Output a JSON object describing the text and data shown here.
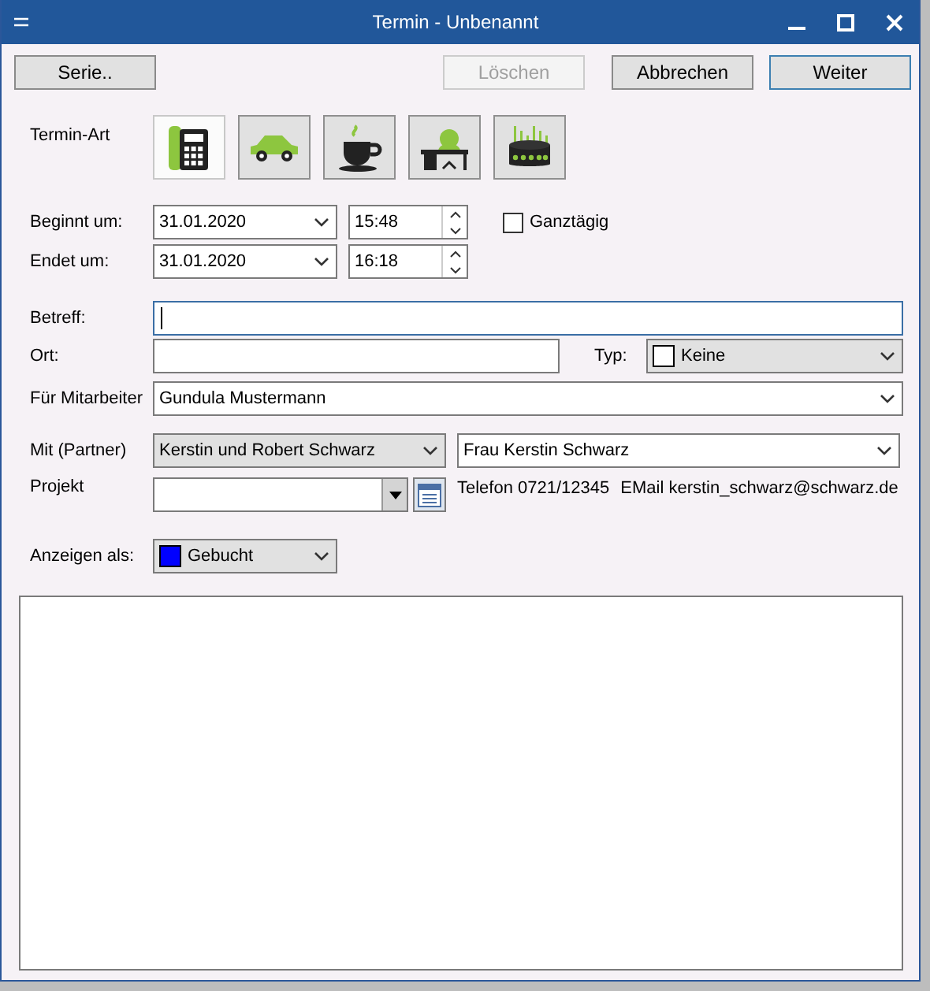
{
  "window": {
    "title": "Termin - Unbenannt"
  },
  "buttons": [
    {
      "label": "Serie..",
      "disabled": false,
      "focused": false
    },
    {
      "label": "Löschen",
      "disabled": true,
      "focused": false
    },
    {
      "label": "Abbrechen",
      "disabled": false,
      "focused": false
    },
    {
      "label": "Weiter",
      "disabled": false,
      "focused": true
    }
  ],
  "termin_art": {
    "label": "Termin-Art",
    "types": [
      {
        "kind": "phone",
        "selected": true
      },
      {
        "kind": "car",
        "selected": false
      },
      {
        "kind": "coffee",
        "selected": false
      },
      {
        "kind": "desk",
        "selected": false
      },
      {
        "kind": "cake",
        "selected": false
      }
    ]
  },
  "beginn": {
    "label": "Beginnt um:",
    "date": "31.01.2020",
    "time": "15:48"
  },
  "ende": {
    "label": "Endet um:",
    "date": "31.01.2020",
    "time": "16:18"
  },
  "ganztaegig": {
    "label": "Ganztägig",
    "checked": false
  },
  "betreff": {
    "label": "Betreff:",
    "focused": true
  },
  "ort": {
    "label": "Ort:"
  },
  "typ": {
    "label": "Typ:",
    "value": "Keine",
    "color": "#ffffff"
  },
  "mitarbeiter": {
    "label": "Für Mitarbeiter",
    "value": "Gundula Mustermann"
  },
  "partner": {
    "label": "Mit (Partner)",
    "company": "Kerstin und Robert Schwarz",
    "contact": "Frau Kerstin Schwarz",
    "phone": "Telefon 0721/12345",
    "email": "EMail kerstin_schwarz@schwarz.de"
  },
  "projekt": {
    "label": "Projekt"
  },
  "anzeigen": {
    "label": "Anzeigen als:",
    "value": "Gebucht",
    "color": "#0000ff"
  }
}
